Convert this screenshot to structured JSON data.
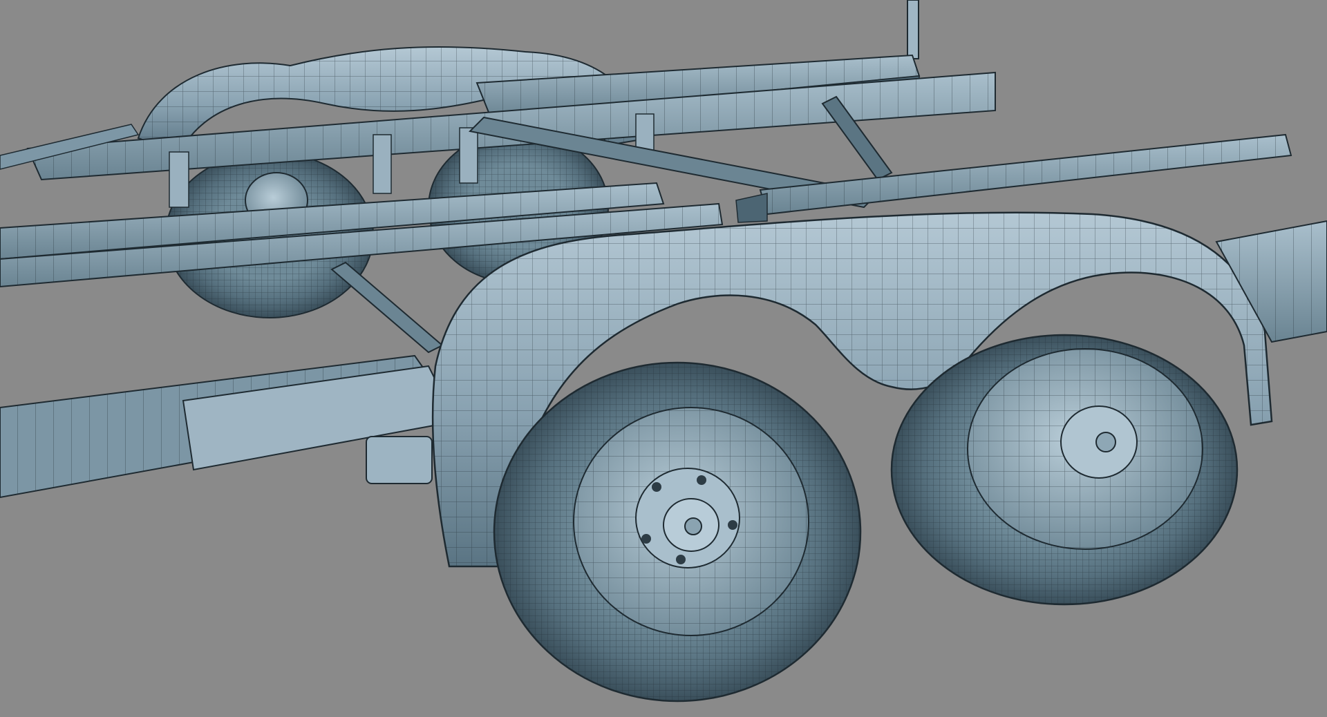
{
  "viewport": {
    "background": "#8a8a8a",
    "subject": "boat-trailer-wireframe-render"
  },
  "palette": {
    "surface": "#6f8a98",
    "surface_light": "#a6bccb",
    "surface_mid": "#87a1b0",
    "surface_dark": "#3f5664",
    "wire": "#1e2a31",
    "tire": "#55707e",
    "tire_dark": "#2d3c45",
    "hub": "#a8c0ce"
  },
  "shading": "wireframe-over-shaded"
}
